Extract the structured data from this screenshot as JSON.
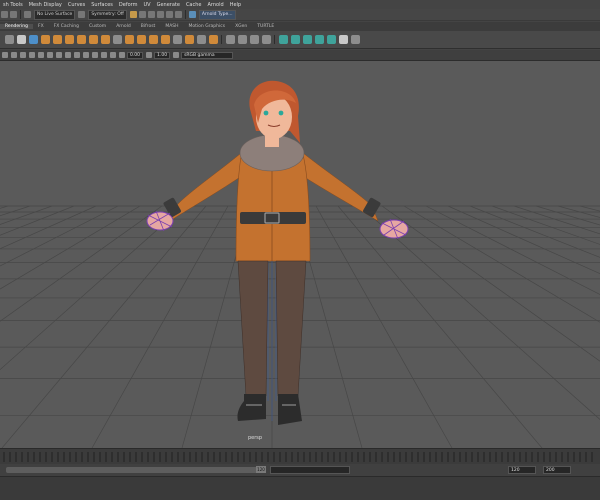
{
  "menu": {
    "items": [
      "sh Tools",
      "Mesh Display",
      "Curves",
      "Surfaces",
      "Deform",
      "UV",
      "Generate",
      "Cache",
      "Arnold",
      "Help"
    ]
  },
  "status_line": {
    "surface_dropdown": "No Live Surface",
    "symmetry_dropdown": "Symmetry: Off",
    "layout_dropdown": "Arnold Type..."
  },
  "shelf": {
    "tabs": [
      "Rendering",
      "FX",
      "FX Caching",
      "Custom",
      "Arnold",
      "Bifrost",
      "MASH",
      "Motion Graphics",
      "XGen",
      "TURTLE"
    ],
    "active_tab": "Rendering"
  },
  "panel_toolbar": {
    "value_a": "0.00",
    "value_b": "1.00",
    "color_space": "sRGB gamma"
  },
  "viewport": {
    "camera_label": "persp"
  },
  "range_slider": {
    "start_field": "",
    "end_handle": "120",
    "end_field": "120",
    "total_field": "200"
  },
  "colors": {
    "jacket": "#c4722f",
    "fur": "#8d7f7a",
    "pants": "#5e4a40",
    "hair": "#c0582f",
    "skin": "#f0b89a",
    "grid": "#474747",
    "ik": "#7a3fb0"
  }
}
